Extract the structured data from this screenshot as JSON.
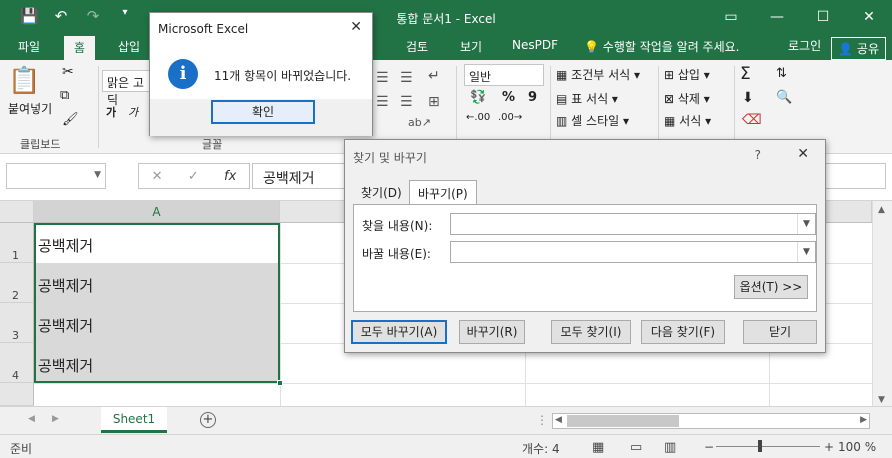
{
  "titlebar": {
    "title": "통합 문서1 - Excel",
    "qat_icons": [
      "save-icon",
      "undo-icon",
      "redo-icon",
      "customize-qat-icon"
    ],
    "minimize": "—",
    "restore": "☐",
    "close": "✕",
    "ribbon_options": "▭"
  },
  "tabs": {
    "items": [
      "파일",
      "홈",
      "삽입",
      "검토",
      "보기",
      "NesPDF"
    ],
    "active": "홈",
    "tell_me": "수행할 작업을 알려 주세요.",
    "sign_in": "로그인",
    "share": "공유"
  },
  "ribbon": {
    "clipboard": {
      "paste": "붙여넣기",
      "label": "클립보드"
    },
    "font": {
      "name": "맑은 고딕",
      "bold": "가",
      "italic": "가",
      "label": "글꼴"
    },
    "number": {
      "format": "일반",
      "percent": "%",
      "comma": "9"
    },
    "styles": {
      "cond": "조건부 서식",
      "table": "표 서식",
      "cell": "셀 스타일"
    },
    "cells": {
      "insert": "삽입",
      "delete": "삭제",
      "format": "서식"
    },
    "editing": {
      "sum": "Σ"
    }
  },
  "formula_bar": {
    "name_box": "",
    "cancel": "✕",
    "enter": "✓",
    "fx": "fx",
    "content": "공백제거"
  },
  "grid": {
    "columns": [
      "A"
    ],
    "rows": [
      "1",
      "2",
      "3",
      "4"
    ],
    "cells": [
      "공백제거",
      "공백제거",
      "공백제거",
      "공백제거"
    ]
  },
  "sheets": {
    "tabs": [
      "Sheet1"
    ],
    "add": "+"
  },
  "status": {
    "ready": "준비",
    "count": "개수: 4",
    "zoom": "100 %",
    "zoom_out": "−",
    "zoom_in": "+"
  },
  "msgbox": {
    "title": "Microsoft Excel",
    "message": "11개 항목이 바뀌었습니다.",
    "icon": "i",
    "ok": "확인",
    "close": "✕"
  },
  "find_replace": {
    "title": "찾기 및 바꾸기",
    "help": "?",
    "close": "✕",
    "tab_find": "찾기(D)",
    "tab_replace": "바꾸기(P)",
    "find_label": "찾을 내용(N):",
    "replace_label": "바꿀 내용(E):",
    "find_value": "",
    "replace_value": "",
    "options": "옵션(T) >>",
    "replace_all": "모두 바꾸기(A)",
    "replace": "바꾸기(R)",
    "find_all": "모두 찾기(I)",
    "find_next": "다음 찾기(F)",
    "close_btn": "닫기"
  },
  "colors": {
    "excel_green": "#217346",
    "accent_blue": "#1a6fc7"
  }
}
